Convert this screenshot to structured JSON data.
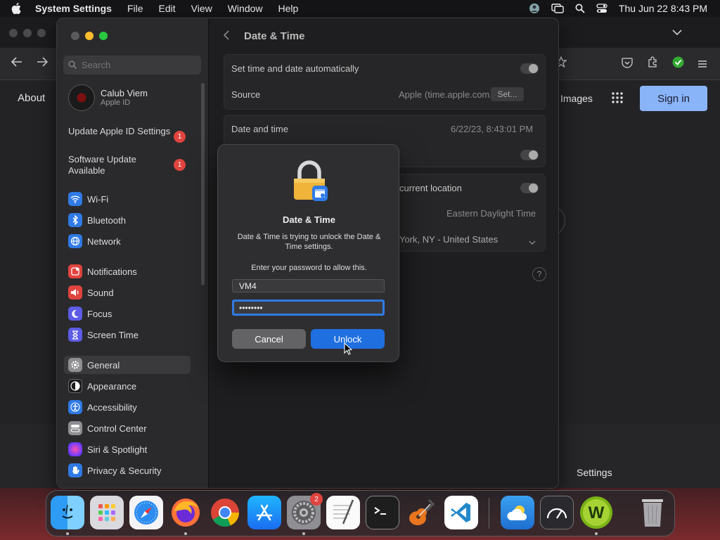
{
  "menubar": {
    "app_name": "System Settings",
    "menus": [
      "File",
      "Edit",
      "View",
      "Window",
      "Help"
    ],
    "clock": "Thu Jun 22  8:43 PM"
  },
  "browser": {
    "about_link": "About",
    "images_link": "Images",
    "signin_label": "Sign in",
    "footer_settings": "Settings"
  },
  "sidebar": {
    "search_placeholder": "Search",
    "user_name": "Calub Viem",
    "user_sub": "Apple ID",
    "notices": [
      {
        "label": "Update Apple ID Settings",
        "count": "1"
      },
      {
        "label": "Software Update Available",
        "count": "1"
      }
    ],
    "items": [
      {
        "label": "Wi-Fi",
        "icon": "wifi-icon",
        "color": "#2f7ae5"
      },
      {
        "label": "Bluetooth",
        "icon": "bluetooth-icon",
        "color": "#2f7ae5"
      },
      {
        "label": "Network",
        "icon": "globe-icon",
        "color": "#2f7ae5"
      },
      {
        "label": "Notifications",
        "icon": "bell-icon",
        "color": "#e0443e"
      },
      {
        "label": "Sound",
        "icon": "speaker-icon",
        "color": "#e0443e"
      },
      {
        "label": "Focus",
        "icon": "moon-icon",
        "color": "#5e5ce6"
      },
      {
        "label": "Screen Time",
        "icon": "hourglass-icon",
        "color": "#5e5ce6"
      },
      {
        "label": "General",
        "icon": "gear-icon",
        "color": "#8e8e93"
      },
      {
        "label": "Appearance",
        "icon": "appearance-icon",
        "color": "#1c1c1e"
      },
      {
        "label": "Accessibility",
        "icon": "accessibility-icon",
        "color": "#2f7ae5"
      },
      {
        "label": "Control Center",
        "icon": "control-center-icon",
        "color": "#8e8e93"
      },
      {
        "label": "Siri & Spotlight",
        "icon": "siri-icon",
        "color": "#b04fd6"
      },
      {
        "label": "Privacy & Security",
        "icon": "hand-icon",
        "color": "#2f7ae5"
      }
    ]
  },
  "content": {
    "title": "Date & Time",
    "auto_label": "Set time and date automatically",
    "source_label": "Source",
    "source_value": "Apple (time.apple.com.)",
    "set_button": "Set...",
    "datetime_label": "Date and time",
    "datetime_value": "6/22/23, 8:43:01 PM",
    "location_label": "current location",
    "timezone_value": "Eastern Daylight Time",
    "city_value": "York, NY - United States",
    "help": "?"
  },
  "dialog": {
    "title": "Date & Time",
    "message": "Date & Time is trying to unlock the Date & Time settings.",
    "prompt": "Enter your password to allow this.",
    "username": "VM4",
    "password": "••••••••",
    "cancel_label": "Cancel",
    "unlock_label": "Unlock"
  },
  "dock": {
    "finder_badge": "",
    "settings_badge": "2"
  },
  "colors": {
    "accent": "#1f6fe0",
    "badge": "#e0443e",
    "signin": "#8ab4f8"
  }
}
